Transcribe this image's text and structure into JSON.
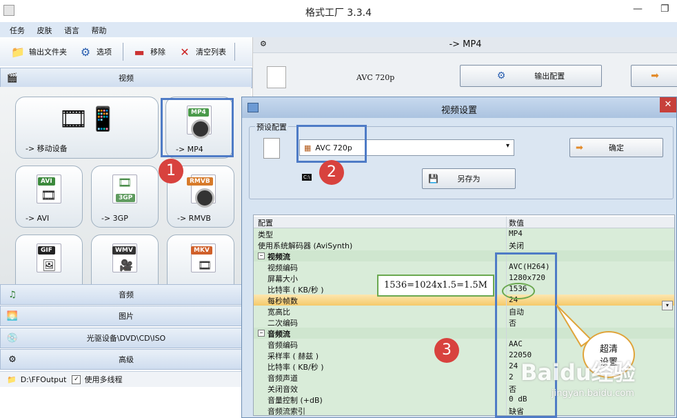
{
  "window": {
    "title": "格式工厂 3.3.4",
    "minimize": "—",
    "restore": "❐"
  },
  "menu": [
    "任务",
    "皮肤",
    "语言",
    "帮助"
  ],
  "toolbar": {
    "output_folder": "输出文件夹",
    "options": "选项",
    "remove": "移除",
    "clear_list": "清空列表"
  },
  "categories": {
    "video": "视频",
    "audio": "音频",
    "image": "图片",
    "disc": "光驱设备\\DVD\\CD\\ISO",
    "advanced": "高级"
  },
  "video_tiles": [
    {
      "label": "-> 移动设备"
    },
    {
      "label": "-> MP4",
      "badge": "MP4"
    },
    {
      "label": "-> AVI",
      "badge": "AVI"
    },
    {
      "label": "-> 3GP",
      "badge": "3GP"
    },
    {
      "label": "-> RMVB",
      "badge": "RMVB"
    },
    {
      "label": "",
      "badge": "GIF"
    },
    {
      "label": "",
      "badge": "WMV"
    },
    {
      "label": "",
      "badge": "MKV"
    }
  ],
  "statusbar": {
    "path": "D:\\FFOutput",
    "multithread_label": "使用多线程",
    "checkbox": "✓"
  },
  "mp4_panel": {
    "title": "-> MP4",
    "preset_text": "AVC 720p",
    "output_config_button": "输出配置"
  },
  "dialog": {
    "title": "视频设置",
    "close": "✕",
    "preset_legend": "预设配置",
    "preset_value": "AVC 720p",
    "ok_button": "确定",
    "save_as_button": "另存为",
    "grid_headers": {
      "key": "配置",
      "value": "数值"
    },
    "rows": [
      {
        "k": "类型",
        "v": "MP4"
      },
      {
        "k": "使用系统解码器 (AviSynth)",
        "v": "关闭"
      },
      {
        "k": "视频流",
        "v": "",
        "section": true
      },
      {
        "k": "视频编码",
        "v": "AVC(H264)"
      },
      {
        "k": "屏幕大小",
        "v": "1280x720"
      },
      {
        "k": "比特率 ( KB/秒 )",
        "v": "1536"
      },
      {
        "k": "每秒帧数",
        "v": "24",
        "highlight": true
      },
      {
        "k": "宽高比",
        "v": "自动"
      },
      {
        "k": "二次编码",
        "v": "否"
      },
      {
        "k": "音频流",
        "v": "",
        "section": true
      },
      {
        "k": "音频编码",
        "v": "AAC"
      },
      {
        "k": "采样率 ( 赫兹 )",
        "v": "22050"
      },
      {
        "k": "比特率 ( KB/秒 )",
        "v": "24"
      },
      {
        "k": "音频声道",
        "v": "2"
      },
      {
        "k": "关闭音效",
        "v": "否"
      },
      {
        "k": "音量控制 (+dB)",
        "v": "0 dB"
      },
      {
        "k": "音频流索引",
        "v": "缺省"
      }
    ]
  },
  "annotations": {
    "n1": "1",
    "n2": "2",
    "n3": "3",
    "bitrate_note": "1536=1024x1.5=1.5M",
    "bubble": "超清\n设置",
    "cmd_icon": "C:\\"
  },
  "watermark": {
    "logo": "Baidu经验",
    "url": "jingyan.baidu.com"
  },
  "colors": {
    "accent": "#4e7bc6",
    "badge_red": "#d8423e",
    "section_bg": "#cfe6cf"
  }
}
